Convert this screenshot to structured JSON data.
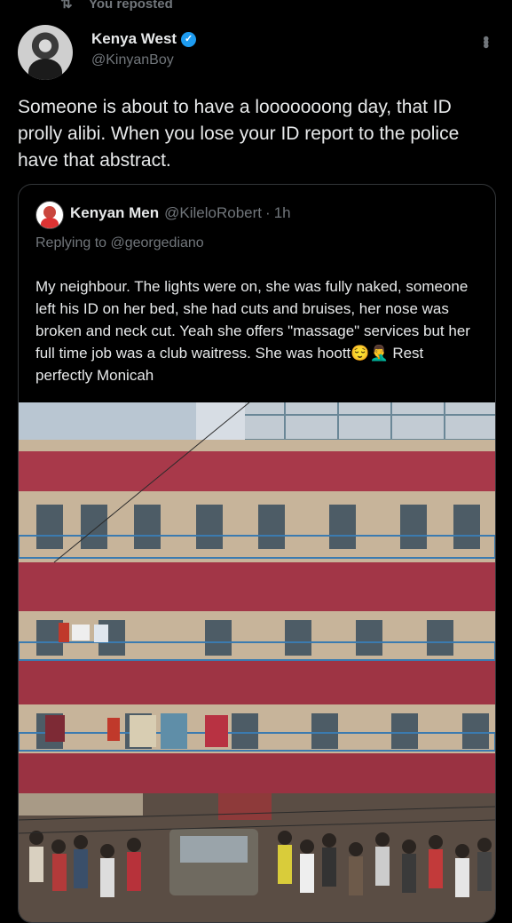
{
  "repost": {
    "icon": "repost-icon",
    "label": "You reposted"
  },
  "tweet": {
    "author_name": "Kenya West",
    "author_handle": "@KinyanBoy",
    "verified_icon": "verified-badge-icon",
    "more_icon": "more-options-icon",
    "text": "Someone is about to have a looooooong day, that ID prolly alibi. When you lose your ID report to the police have that abstract."
  },
  "quote": {
    "author_name": "Kenyan Men",
    "author_handle": "@KileloRobert",
    "separator": "·",
    "time": "1h",
    "replying_to": "Replying to @georgediano",
    "text": "My neighbour. The lights were on, she was fully naked, someone left his ID on her bed, she had cuts and bruises, her nose was broken and neck cut. Yeah she offers \"massage\" services but her full time job was a club waitress. She was hoott😌🤦‍♂️ Rest perfectly Monicah"
  },
  "colors": {
    "background": "#000000",
    "text": "#e7e9ea",
    "secondary": "#71767b",
    "accent": "#1d9bf0",
    "border": "#333639"
  }
}
